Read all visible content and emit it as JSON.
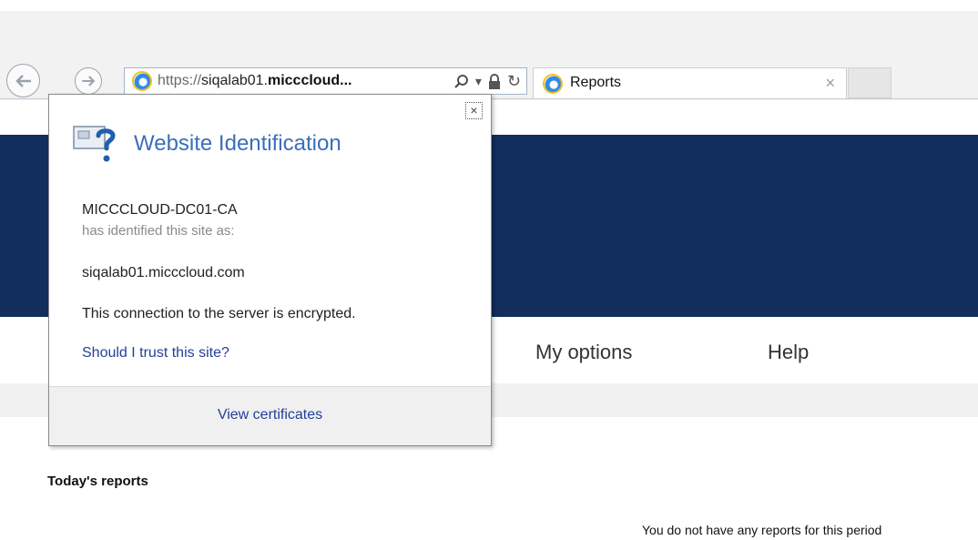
{
  "browser": {
    "address": {
      "protocol": "https://",
      "host_part1": "siqalab01.",
      "host_part2": "micccloud...",
      "search_glyph": "⚲",
      "dropdown_glyph": "▾",
      "refresh_glyph": "↻"
    },
    "tab": {
      "title": "Reports",
      "close_glyph": "×"
    }
  },
  "page": {
    "nav": {
      "my_options": "My options",
      "help": "Help"
    },
    "section_heading": "Today's reports",
    "empty_message": "You do not have any reports for this period"
  },
  "popup": {
    "title": "Website Identification",
    "close_glyph": "×",
    "issuer": "MICCCLOUD-DC01-CA",
    "identified_label": "has identified this site as:",
    "site": "siqalab01.micccloud.com",
    "encryption": "This connection to the server is encrypted.",
    "trust_link": "Should I trust this site?",
    "view_certificates": "View certificates"
  },
  "colors": {
    "banner": "#112e5d",
    "link": "#22409a",
    "title": "#3a6fb8"
  }
}
